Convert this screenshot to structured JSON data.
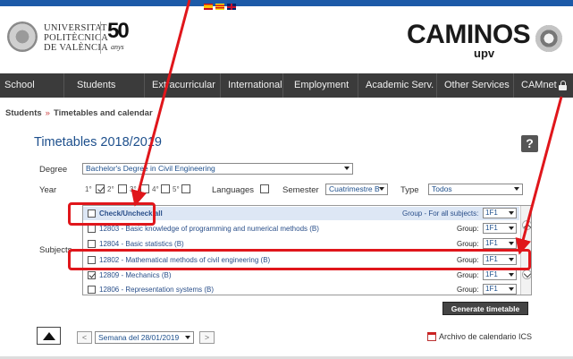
{
  "header": {
    "university_name": [
      "UNIVERSITAT",
      "POLITÈCNICA",
      "DE VALÈNCIA"
    ],
    "anniversary_number": "50",
    "anniversary_label": "anys",
    "school_brand": "CAMINOS",
    "school_brand_sub": "upv",
    "languages": [
      "es",
      "ca",
      "en"
    ]
  },
  "nav": {
    "items": [
      "School",
      "Students",
      "Extracurricular",
      "International",
      "Employment",
      "Academic Serv.",
      "Other Services",
      "CAMnet"
    ]
  },
  "breadcrumb": {
    "items": [
      "Students",
      "Timetables and calendar"
    ],
    "separator": "»"
  },
  "page": {
    "title": "Timetables 2018/2019",
    "help_label": "?"
  },
  "form": {
    "degree_label": "Degree",
    "degree_value": "Bachelor's Degree in Civil Engineering",
    "year_label": "Year",
    "languages_label": "Languages",
    "semester_label": "Semester",
    "semester_value": "Cuatrimestre B",
    "type_label": "Type",
    "type_value": "Todos",
    "subjects_label": "Subjects"
  },
  "subjects": {
    "check_all_label": "Check/Uncheck all",
    "group_all_label": "Group - For all subjects:",
    "group_all_value": "1F1",
    "group_label": "Group:",
    "rows": [
      {
        "label": "12803 - Basic knowledge of programming and numerical methods (B)",
        "group": "1F1",
        "checked": false
      },
      {
        "label": "12804 - Basic statistics (B)",
        "group": "1F1",
        "checked": false
      },
      {
        "label": "12802 - Mathematical methods of civil engineering (B)",
        "group": "1F1",
        "checked": false
      },
      {
        "label": "12809 - Mechanics (B)",
        "group": "1F1",
        "checked": true
      },
      {
        "label": "12806 - Representation systems (B)",
        "group": "1F1",
        "checked": false
      }
    ]
  },
  "actions": {
    "generate_label": "Generate timetable",
    "week_value": "Semana del 28/01/2019",
    "prev_label": "<",
    "next_label": ">",
    "ics_label": "Archivo de calendario ICS"
  },
  "colors": {
    "accent_blue": "#1d4f8c",
    "nav_background": "#3b3b3b",
    "annotation_red": "#e0161b"
  }
}
